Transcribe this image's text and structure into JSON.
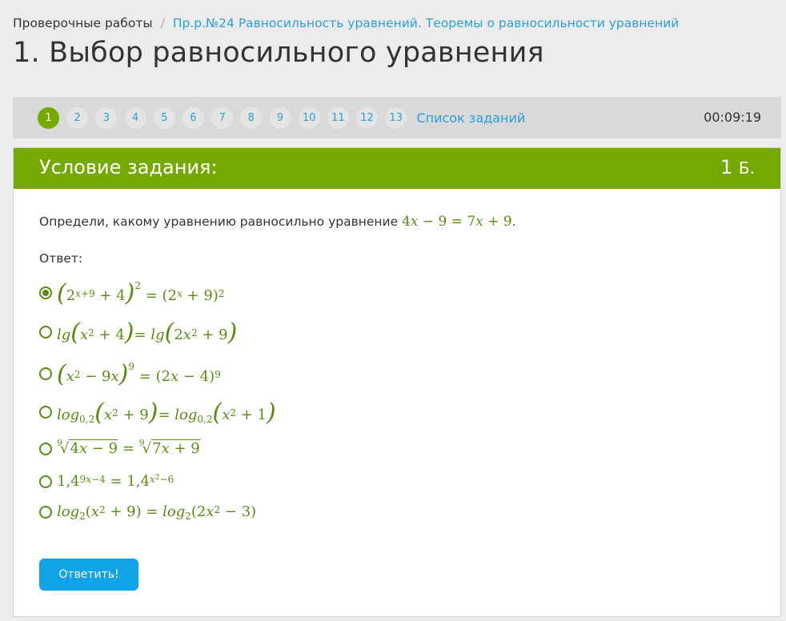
{
  "breadcrumb": {
    "root": "Проверочные работы",
    "separator": "/",
    "current": "Пр.р.№24 Равносильность уравнений. Теоремы о равносильности уравнений"
  },
  "page_title": "1. Выбор равносильного уравнения",
  "task_nav": {
    "items": [
      "1",
      "2",
      "3",
      "4",
      "5",
      "6",
      "7",
      "8",
      "9",
      "10",
      "11",
      "12",
      "13"
    ],
    "active_index": 0,
    "list_link": "Список заданий",
    "timer": "00:09:19"
  },
  "task": {
    "header_title": "Условие задания:",
    "points": "1",
    "points_unit": "Б.",
    "question_text": "Определи, какому уравнению равносильно уравнение",
    "question_equation": "4x − 9 = 7x + 9",
    "question_end": ".",
    "answer_label": "Ответ:",
    "options": [
      {
        "text": "(2^(x+9) + 4)^2 = (2^x + 9)^2",
        "selected": true
      },
      {
        "text": "lg(x^2 + 4) = lg(2x^2 + 9)",
        "selected": false
      },
      {
        "text": "(x^2 − 9x)^9 = (2x − 4)^9",
        "selected": false
      },
      {
        "text": "log_0,2(x^2 + 9) = log_0,2(x^2 + 1)",
        "selected": false
      },
      {
        "text": "9√(4x − 9) = 9√(7x + 9)",
        "selected": false
      },
      {
        "text": "1,4^(9x−4) = 1,4^(x^2−6)",
        "selected": false
      },
      {
        "text": "log_2(x^2 + 9) = log_2(2x^2 − 3)",
        "selected": false
      }
    ],
    "submit_label": "Ответить!"
  },
  "colors": {
    "accent_green": "#76a900",
    "math_green": "#5a8b13",
    "link_blue": "#2a9fd6",
    "button_blue": "#10a4e6"
  }
}
